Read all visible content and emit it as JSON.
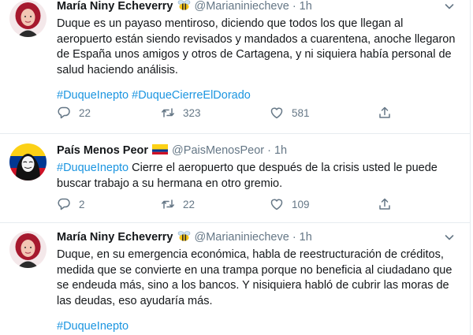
{
  "tweets": [
    {
      "name": "María Niny Echeverry",
      "badge": "bee-emoji",
      "handle": "@Marianiniecheve",
      "dot": "·",
      "time": "1h",
      "text": "Duque es un payaso mentiroso, diciendo que todos los que llegan al aeropuerto están siendo revisados y mandados a cuarentena, anoche llegaron de España unos amigos y otros de Cartagena, y ni siquiera había personal de salud haciendo análisis.",
      "hashtags": [
        "#DuqueInepto",
        "#DuqueCierreElDorado"
      ],
      "replies": "22",
      "retweets": "323",
      "likes": "581"
    },
    {
      "name": "País Menos Peor",
      "badge": "colombia-flag",
      "handle": "@PaisMenosPeor",
      "dot": "·",
      "time": "1h",
      "hashtag_lead": "#DuqueInepto",
      "text": " Cierre el aeropuerto que después de la crisis usted le puede buscar trabajo a su hermana en otro gremio.",
      "replies": "2",
      "retweets": "22",
      "likes": "109"
    },
    {
      "name": "María Niny Echeverry",
      "badge": "bee-emoji",
      "handle": "@Marianiniecheve",
      "dot": "·",
      "time": "1h",
      "text": "Duque, en su emergencia económica, habla de reestructuración de créditos, medida que se convierte en una trampa porque no beneficia al ciudadano que se endeuda más, sino a los bancos. Y nisiquiera habló de cubrir las moras de las deudas, eso ayudaría más.",
      "hashtags": [
        "#DuqueInepto"
      ]
    }
  ],
  "colors": {
    "link": "#1b95e0",
    "secondary": "#657786",
    "border": "#e6ecf0"
  }
}
